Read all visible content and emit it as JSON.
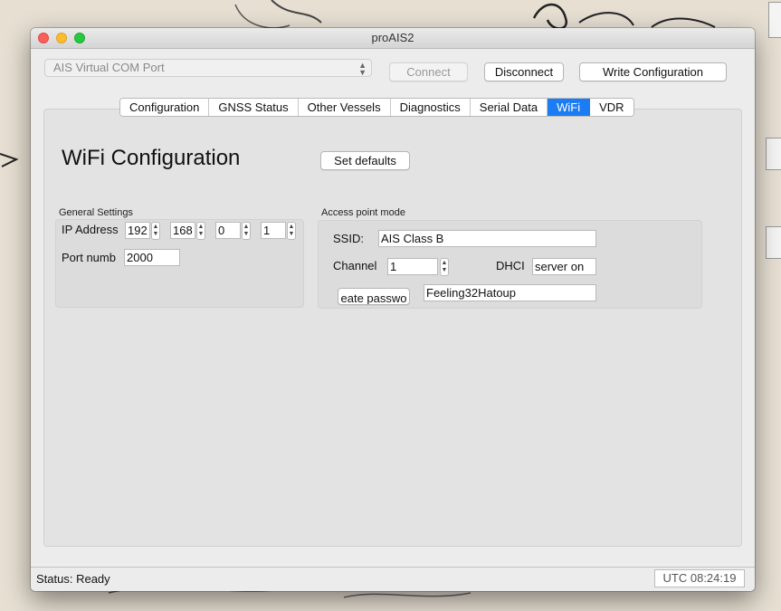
{
  "window": {
    "title": "proAIS2"
  },
  "toolbar": {
    "port_select_value": "AIS Virtual COM Port",
    "connect_label": "Connect",
    "disconnect_label": "Disconnect",
    "write_config_label": "Write Configuration"
  },
  "tabs": [
    {
      "label": "Configuration"
    },
    {
      "label": "GNSS Status"
    },
    {
      "label": "Other Vessels"
    },
    {
      "label": "Diagnostics"
    },
    {
      "label": "Serial Data"
    },
    {
      "label": "WiFi"
    },
    {
      "label": "VDR"
    }
  ],
  "active_tab": "WiFi",
  "wifi": {
    "title": "WiFi Configuration",
    "set_defaults_label": "Set defaults",
    "general": {
      "group_label": "General Settings",
      "ip_label": "IP Address",
      "ip_octets": [
        "192",
        "168",
        "0",
        "1"
      ],
      "port_label": "Port numb",
      "port_value": "2000"
    },
    "access_point": {
      "group_label": "Access point mode",
      "ssid_label": "SSID:",
      "ssid_value": "AIS Class B",
      "channel_label": "Channel",
      "channel_value": "1",
      "dhcp_label": "DHCI",
      "dhcp_value": "server on",
      "create_password_label": "eate passwo",
      "password_value": "Feeling32Hatoup"
    }
  },
  "status": {
    "text": "Status: Ready",
    "utc_time": "UTC  08:24:19"
  },
  "colors": {
    "accent": "#1b7cf4"
  },
  "icons": {
    "stepper": "stepper-arrows-icon",
    "combo": "chevron-updown-icon"
  }
}
